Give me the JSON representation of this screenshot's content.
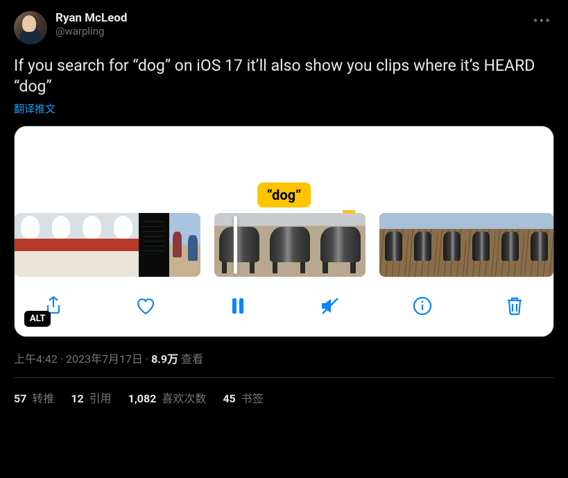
{
  "user": {
    "display_name": "Ryan McLeod",
    "handle": "@warpling"
  },
  "tweet": {
    "text": "If you search for “dog” on iOS 17 it’ll also show you clips where it’s HEARD “dog”",
    "translate_label": "翻译推文"
  },
  "media": {
    "caption_bubble": "“dog”",
    "alt_label": "ALT"
  },
  "meta": {
    "time": "上午4:42",
    "separator": " · ",
    "date": "2023年7月17日",
    "views_count": "8.9万",
    "views_label": " 查看"
  },
  "stats": {
    "retweets": {
      "count": "57",
      "label": " 转推"
    },
    "quotes": {
      "count": "12",
      "label": " 引用"
    },
    "likes": {
      "count": "1,082",
      "label": " 喜欢次数"
    },
    "bookmarks": {
      "count": "45",
      "label": " 书签"
    }
  }
}
